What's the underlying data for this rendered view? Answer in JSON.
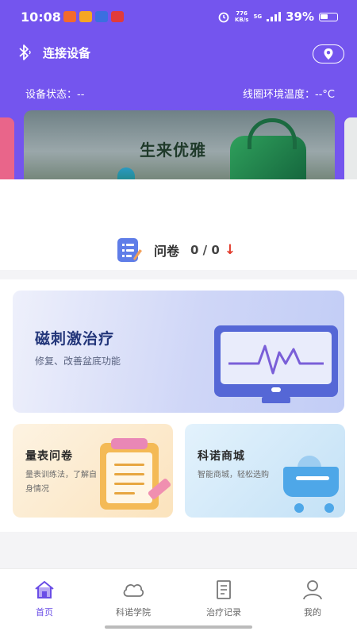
{
  "status_bar": {
    "time": "10:08",
    "net_speed_value": "776",
    "net_speed_unit": "KB/s",
    "signal": "5G",
    "battery": "39%"
  },
  "header": {
    "connect_label": "连接设备",
    "device_status": "设备状态：--",
    "coil_temperature": "线圈环境温度：--°C"
  },
  "banner": {
    "title": "生来优雅",
    "icons": [
      "bluetooth-icon",
      "location-icon"
    ]
  },
  "questionnaire": {
    "label": "问卷",
    "count": "0 / 0",
    "arrow": "↓"
  },
  "cards": {
    "therapy": {
      "title": "磁刺激治疗",
      "subtitle": "修复、改善盆底功能"
    },
    "survey": {
      "title": "量表问卷",
      "subtitle": "量表训练法，了解自身情况"
    },
    "shop": {
      "title": "科诺商城",
      "subtitle": "智能商城，轻松选购"
    }
  },
  "bottom_nav": {
    "items": [
      {
        "label": "首页",
        "icon": "home-icon",
        "active": true
      },
      {
        "label": "科诺学院",
        "icon": "cloud-icon",
        "active": false
      },
      {
        "label": "治疗记录",
        "icon": "record-icon",
        "active": false
      },
      {
        "label": "我的",
        "icon": "user-icon",
        "active": false
      }
    ]
  },
  "colors": {
    "primary": "#7455ee",
    "active_nav": "#6a4de6",
    "down_arrow": "#e23b2b"
  }
}
